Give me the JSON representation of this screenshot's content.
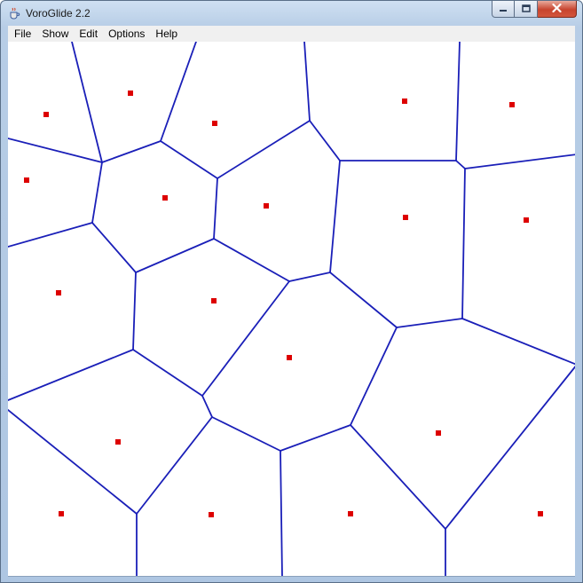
{
  "window": {
    "title": "VoroGlide 2.2"
  },
  "icons": {
    "app": "java-cup-icon",
    "minimize": "minimize-icon",
    "maximize": "maximize-icon",
    "close": "close-icon"
  },
  "menu": {
    "items": [
      {
        "label": "File"
      },
      {
        "label": "Show"
      },
      {
        "label": "Edit"
      },
      {
        "label": "Options"
      },
      {
        "label": "Help"
      }
    ]
  },
  "colors": {
    "edge": "#1a1fb8",
    "site": "#dd0000",
    "canvas_bg": "#ffffff"
  }
}
